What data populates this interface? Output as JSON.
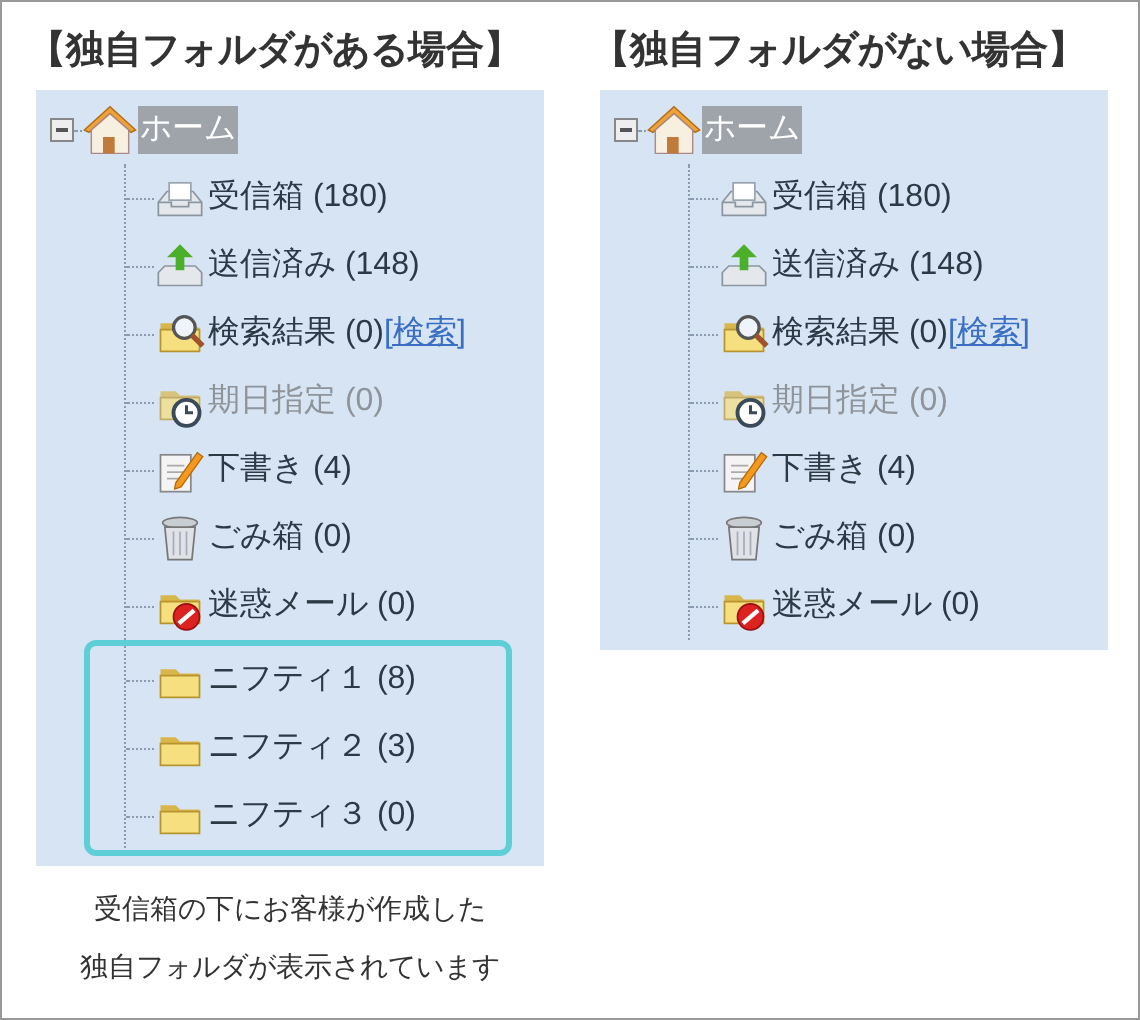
{
  "panels": [
    {
      "title": "【独自フォルダがある場合】",
      "tree": {
        "label": "ホーム",
        "selected": true,
        "expanded": true,
        "children": [
          {
            "kind": "inbox",
            "label": "受信箱 (180)",
            "disabled": false
          },
          {
            "kind": "sent",
            "label": "送信済み (148)",
            "disabled": false
          },
          {
            "kind": "search",
            "label": "検索結果 (0)",
            "link": "[検索]",
            "disabled": false
          },
          {
            "kind": "due",
            "label": "期日指定 (0)",
            "disabled": true
          },
          {
            "kind": "draft",
            "label": "下書き (4)",
            "disabled": false
          },
          {
            "kind": "trash",
            "label": "ごみ箱 (0)",
            "disabled": false
          },
          {
            "kind": "spam",
            "label": "迷惑メール (0)",
            "disabled": false
          }
        ],
        "custom_folders": [
          {
            "kind": "folder",
            "label": "ニフティ１ (8)",
            "disabled": false
          },
          {
            "kind": "folder",
            "label": "ニフティ２ (3)",
            "disabled": false
          },
          {
            "kind": "folder",
            "label": "ニフティ３ (0)",
            "disabled": false
          }
        ]
      },
      "caption": [
        "受信箱の下にお客様が作成した",
        "独自フォルダが表示されています"
      ]
    },
    {
      "title": "【独自フォルダがない場合】",
      "tree": {
        "label": "ホーム",
        "selected": true,
        "expanded": true,
        "children": [
          {
            "kind": "inbox",
            "label": "受信箱 (180)",
            "disabled": false
          },
          {
            "kind": "sent",
            "label": "送信済み (148)",
            "disabled": false
          },
          {
            "kind": "search",
            "label": "検索結果 (0)",
            "link": "[検索]",
            "disabled": false
          },
          {
            "kind": "due",
            "label": "期日指定 (0)",
            "disabled": true
          },
          {
            "kind": "draft",
            "label": "下書き (4)",
            "disabled": false
          },
          {
            "kind": "trash",
            "label": "ごみ箱 (0)",
            "disabled": false
          },
          {
            "kind": "spam",
            "label": "迷惑メール (0)",
            "disabled": false
          }
        ]
      }
    }
  ]
}
